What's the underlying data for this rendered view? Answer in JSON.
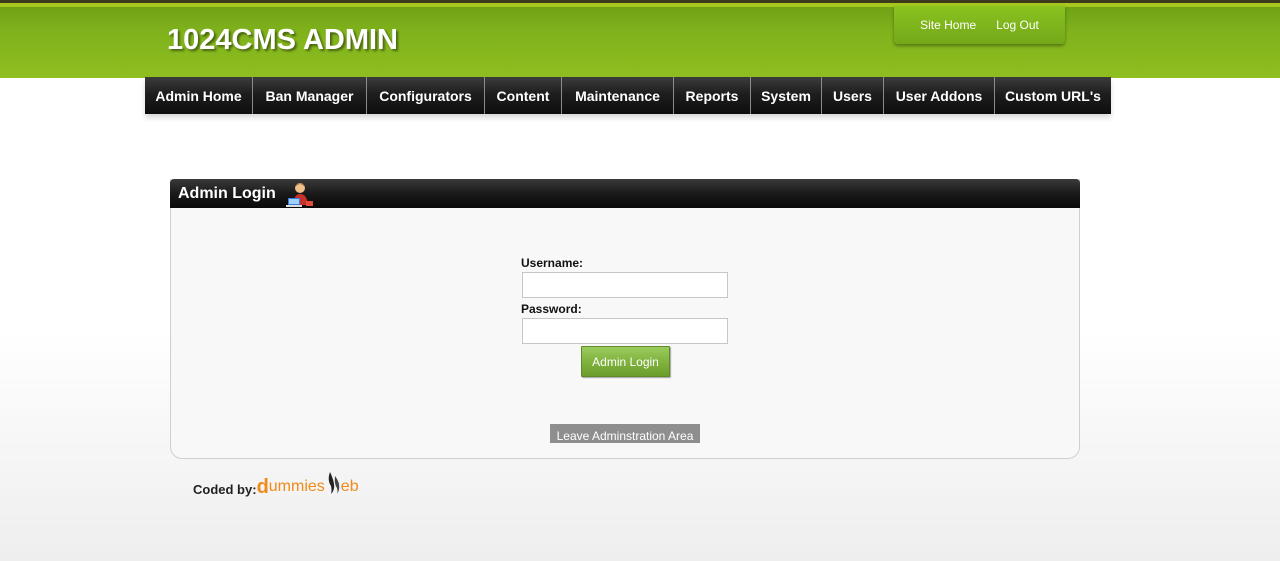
{
  "header": {
    "logo": "1024CMS ADMIN",
    "links": [
      "Site Home",
      "Log Out"
    ]
  },
  "nav": {
    "items": [
      {
        "label": "Admin Home",
        "width": 108
      },
      {
        "label": "Ban Manager",
        "width": 114
      },
      {
        "label": "Configurators",
        "width": 118
      },
      {
        "label": "Content",
        "width": 77
      },
      {
        "label": "Maintenance",
        "width": 112
      },
      {
        "label": "Reports",
        "width": 77
      },
      {
        "label": "System",
        "width": 71
      },
      {
        "label": "Users",
        "width": 62
      },
      {
        "label": "User Addons",
        "width": 111
      },
      {
        "label": "Custom URL's",
        "width": 116
      }
    ]
  },
  "panel": {
    "title": "Admin Login",
    "icon": "admin-user-icon"
  },
  "form": {
    "username_label": "Username:",
    "username_value": "",
    "password_label": "Password:",
    "password_value": "",
    "submit_label": "Admin Login",
    "leave_label": "Leave Adminstration Area"
  },
  "footer": {
    "credit_label": "Coded by:",
    "brand_d": "d",
    "brand_mid": "ummies",
    "brand_end": "eb"
  },
  "colors": {
    "header_green": "#7fb21c",
    "nav_dark": "#1e1e1e",
    "button_green": "#7fb13d",
    "brand_orange": "#f08a18"
  }
}
